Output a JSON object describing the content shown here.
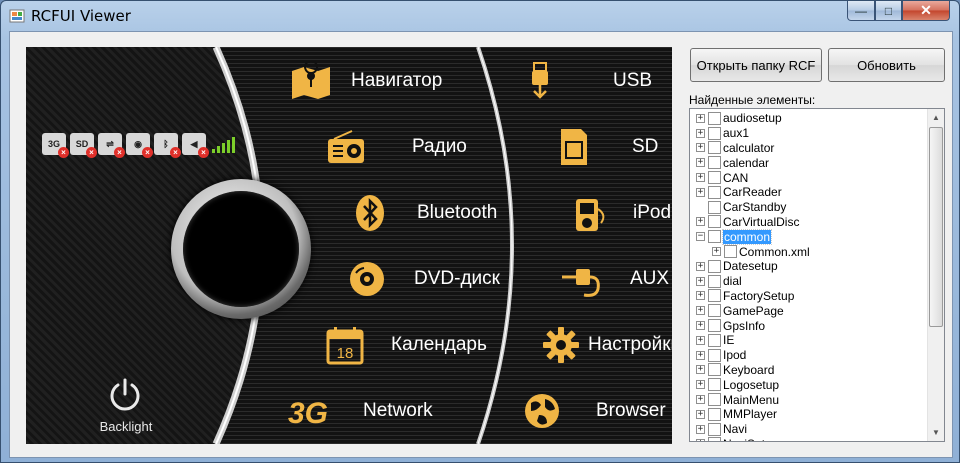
{
  "window": {
    "title": "RCFUI Viewer",
    "min_glyph": "—",
    "max_glyph": "□",
    "close_glyph": "✕"
  },
  "car_ui": {
    "backlight_label": "Backlight",
    "status_icons": [
      {
        "name": "3g-status-icon",
        "glyph": "3G"
      },
      {
        "name": "sd-status-icon",
        "glyph": "SD"
      },
      {
        "name": "usb-status-icon",
        "glyph": "⇌"
      },
      {
        "name": "ipod-status-icon",
        "glyph": "◉"
      },
      {
        "name": "bluetooth-status-icon",
        "glyph": "ᛒ"
      },
      {
        "name": "volume-status-icon",
        "glyph": "◀"
      }
    ],
    "menu_left": [
      {
        "label": "Навигатор",
        "icon": "map-icon"
      },
      {
        "label": "Радио",
        "icon": "radio-icon"
      },
      {
        "label": "Bluetooth",
        "icon": "bluetooth-icon"
      },
      {
        "label": "DVD-диск",
        "icon": "disc-icon"
      },
      {
        "label": "Календарь",
        "icon": "calendar-icon",
        "icon_text": "18"
      },
      {
        "label": "Network",
        "icon": "3g-icon",
        "icon_text": "3G"
      }
    ],
    "menu_right": [
      {
        "label": "USB",
        "icon": "usb-icon"
      },
      {
        "label": "SD",
        "icon": "sd-card-icon"
      },
      {
        "label": "iPod",
        "icon": "ipod-icon"
      },
      {
        "label": "AUX",
        "icon": "aux-icon"
      },
      {
        "label": "Настройки",
        "icon": "gear-icon"
      },
      {
        "label": "Browser",
        "icon": "globe-icon"
      }
    ],
    "accent_color": "#f0b545"
  },
  "panel": {
    "open_button": "Открыть папку RCF",
    "refresh_button": "Обновить",
    "found_label": "Найденные элементы:",
    "tree": [
      {
        "label": "audiosetup",
        "level": 0,
        "expander": "+"
      },
      {
        "label": "aux1",
        "level": 0,
        "expander": "+"
      },
      {
        "label": "calculator",
        "level": 0,
        "expander": "+"
      },
      {
        "label": "calendar",
        "level": 0,
        "expander": "+"
      },
      {
        "label": "CAN",
        "level": 0,
        "expander": "+"
      },
      {
        "label": "CarReader",
        "level": 0,
        "expander": "+"
      },
      {
        "label": "CarStandby",
        "level": 0,
        "expander": ""
      },
      {
        "label": "CarVirtualDisc",
        "level": 0,
        "expander": "+"
      },
      {
        "label": "common",
        "level": 0,
        "expander": "−",
        "selected": true
      },
      {
        "label": "Common.xml",
        "level": 1,
        "expander": "+"
      },
      {
        "label": "Datesetup",
        "level": 0,
        "expander": "+"
      },
      {
        "label": "dial",
        "level": 0,
        "expander": "+"
      },
      {
        "label": "FactorySetup",
        "level": 0,
        "expander": "+"
      },
      {
        "label": "GamePage",
        "level": 0,
        "expander": "+"
      },
      {
        "label": "GpsInfo",
        "level": 0,
        "expander": "+"
      },
      {
        "label": "IE",
        "level": 0,
        "expander": "+"
      },
      {
        "label": "Ipod",
        "level": 0,
        "expander": "+"
      },
      {
        "label": "Keyboard",
        "level": 0,
        "expander": "+"
      },
      {
        "label": "Logosetup",
        "level": 0,
        "expander": "+"
      },
      {
        "label": "MainMenu",
        "level": 0,
        "expander": "+"
      },
      {
        "label": "MMPlayer",
        "level": 0,
        "expander": "+"
      },
      {
        "label": "Navi",
        "level": 0,
        "expander": "+"
      },
      {
        "label": "NaviSet",
        "level": 0,
        "expander": "+"
      }
    ],
    "scroll_up_glyph": "▲",
    "scroll_down_glyph": "▼"
  }
}
